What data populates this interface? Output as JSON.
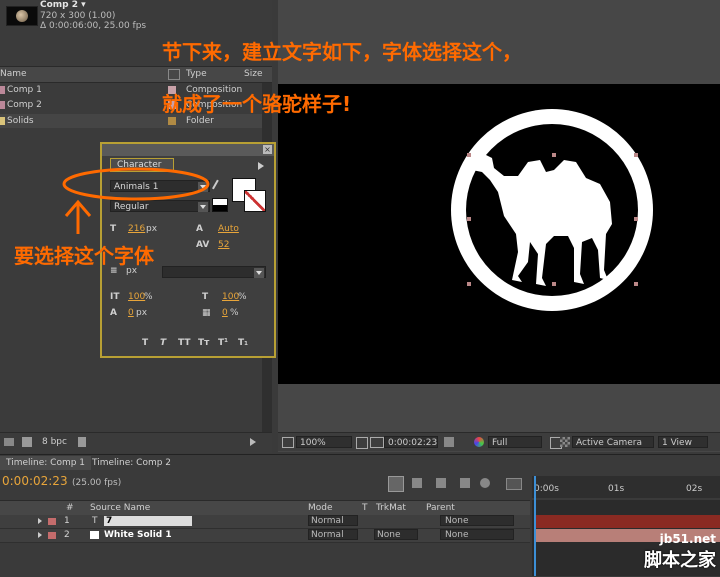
{
  "project": {
    "comp_name": "Comp 2 ▾",
    "comp_size": "720 x 300 (1.00)",
    "comp_duration": "Δ 0:00:06:00, 25.00 fps",
    "columns": {
      "name": "Name",
      "type": "Type",
      "size": "Size"
    },
    "items": [
      {
        "name": "Comp 1",
        "type": "Composition",
        "color": "#c9a1a8"
      },
      {
        "name": "Comp 2",
        "type": "Composition",
        "color": "#c9a1a8"
      },
      {
        "name": "Solids",
        "type": "Folder",
        "color": "#d9c37a"
      }
    ],
    "footer_bpc": "8 bpc"
  },
  "character": {
    "title": "Character",
    "font_family": "Animals 1",
    "font_style": "Regular",
    "font_size": "216",
    "font_size_unit": "px",
    "leading": "Auto",
    "kerning": "52",
    "stroke_width_unit": "px",
    "vscale": "100",
    "hscale": "100",
    "baseline": "0",
    "baseline_unit": "px",
    "tsume": "0",
    "pct": "%"
  },
  "viewer": {
    "zoom": "100%",
    "timecode": "0:00:02:23",
    "resolution": "Full",
    "camera": "Active Camera",
    "view": "1 View"
  },
  "timeline": {
    "tab1": "Timeline: Comp 1",
    "tab2": "Timeline: Comp 2",
    "time": "0:00:02:23",
    "fps": "(25.00 fps)",
    "headers": {
      "hash": "#",
      "source": "Source Name",
      "mode": "Mode",
      "t": "T",
      "trkmat": "TrkMat",
      "parent": "Parent"
    },
    "ruler": [
      "0:00s",
      "01s",
      "02s"
    ],
    "layers": [
      {
        "num": "1",
        "source": "7",
        "mode": "Normal",
        "trkmat": "",
        "parent": "None",
        "color": "#c46c6c"
      },
      {
        "num": "2",
        "source": "White Solid 1",
        "mode": "Normal",
        "trkmat": "None",
        "parent": "None",
        "color": "#c46c6c"
      }
    ]
  },
  "annotations": {
    "line1": "节下来，建立文字如下，字体选择这个，",
    "line2": "就成了一个骆驼样子!",
    "font_hint": "要选择这个字体",
    "color": "#ff6a00"
  },
  "watermark": {
    "site": "jb51.net",
    "name": "脚本之家"
  }
}
